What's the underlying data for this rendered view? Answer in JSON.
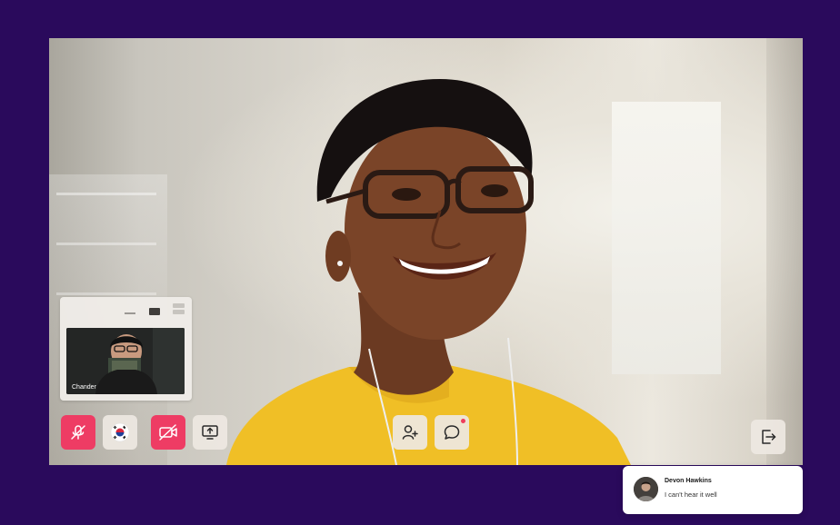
{
  "call": {
    "self_participant_name": "Chander"
  },
  "controls": {
    "mute_icon": "mic-off-icon",
    "language_icon": "south-korea-flag-icon",
    "camera_icon": "video-off-icon",
    "share_icon": "screen-share-icon",
    "add_participant_icon": "add-user-icon",
    "chat_icon": "chat-icon",
    "leave_icon": "leave-icon"
  },
  "chat_notification": {
    "sender": "Devon Hawkins",
    "message": "I can't hear it well"
  },
  "colors": {
    "background": "#2a0a5c",
    "danger": "#ee3c64",
    "button_light": "#eee8e2",
    "unread_dot": "#ef3e5c"
  }
}
